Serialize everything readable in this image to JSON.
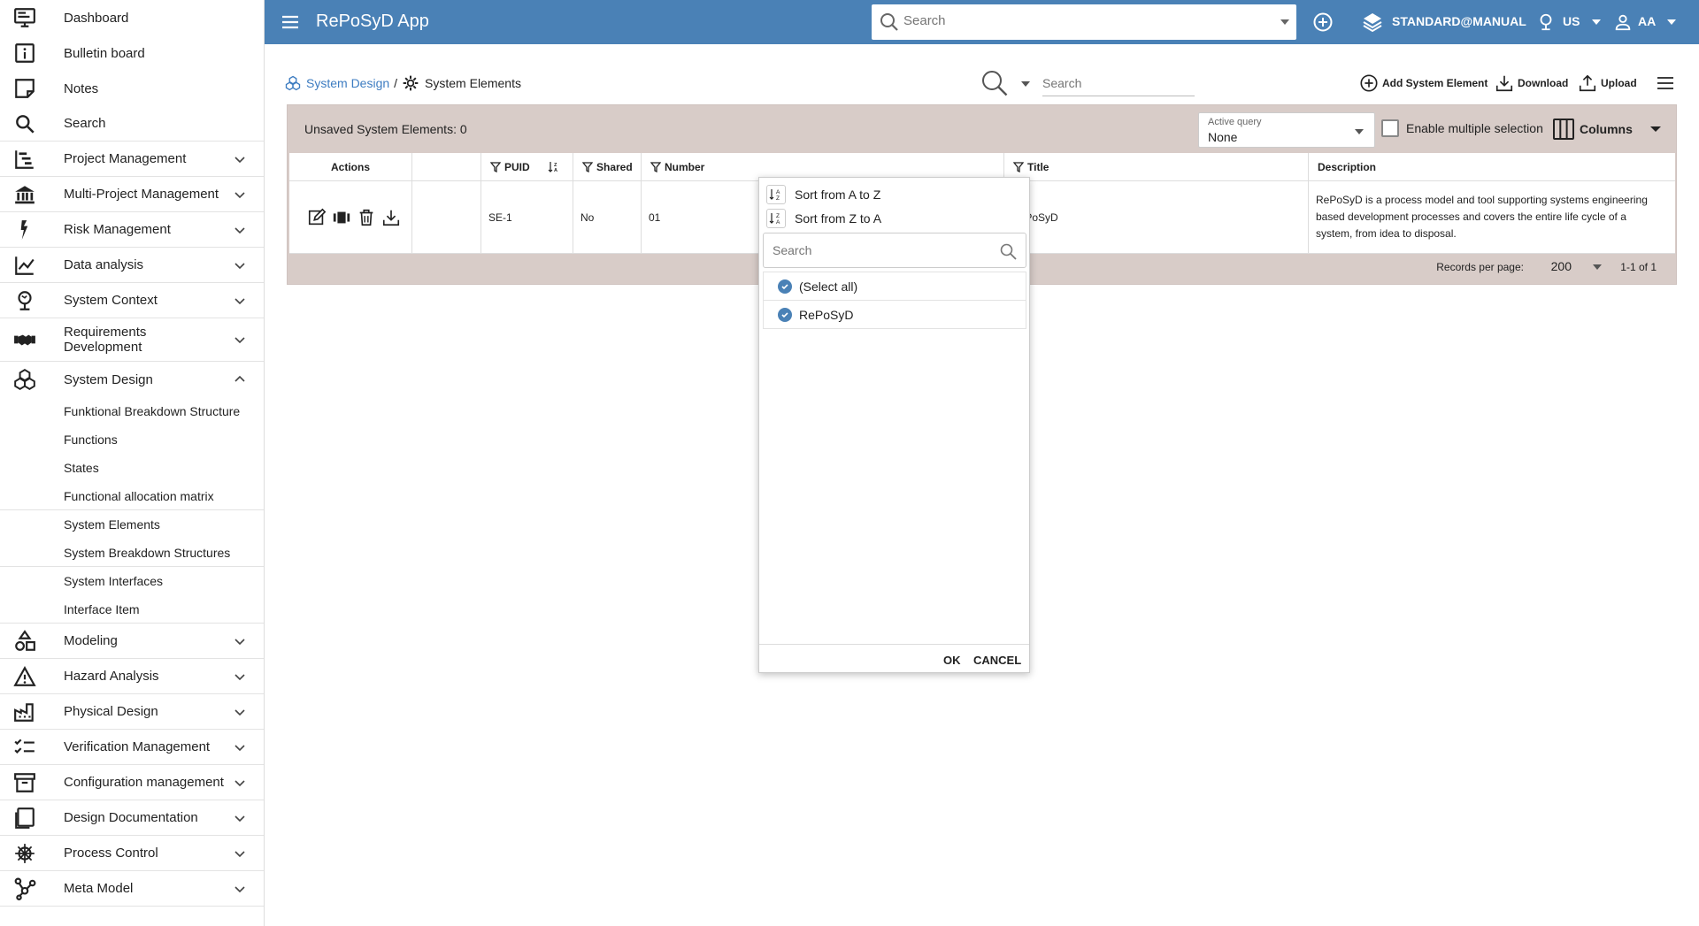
{
  "sidebar": {
    "top_items": [
      {
        "label": "Dashboard",
        "icon": "monitor-icon"
      },
      {
        "label": "Bulletin board",
        "icon": "info-icon"
      },
      {
        "label": "Notes",
        "icon": "note-icon"
      },
      {
        "label": "Search",
        "icon": "search-icon"
      }
    ],
    "sections": [
      {
        "label": "Project Management",
        "icon": "project-icon"
      },
      {
        "label": "Multi-Project Management",
        "icon": "bank-icon"
      },
      {
        "label": "Risk Management",
        "icon": "risk-icon"
      },
      {
        "label": "Data analysis",
        "icon": "chart-line-icon"
      },
      {
        "label": "System Context",
        "icon": "globe-icon"
      },
      {
        "label": "Requirements Development",
        "icon": "handshake-icon"
      }
    ],
    "system_design": {
      "label": "System Design",
      "icon": "cubes-icon",
      "children": [
        "Funktional Breakdown Structure",
        "Functions",
        "States",
        "Functional allocation matrix",
        "System Elements",
        "System Breakdown Structures",
        "System Interfaces",
        "Interface Item"
      ]
    },
    "bottom_sections": [
      {
        "label": "Modeling",
        "icon": "shapes-icon"
      },
      {
        "label": "Hazard Analysis",
        "icon": "warning-icon"
      },
      {
        "label": "Physical Design",
        "icon": "factory-icon"
      },
      {
        "label": "Verification Management",
        "icon": "checklist-icon"
      },
      {
        "label": "Configuration management",
        "icon": "archive-icon"
      },
      {
        "label": "Design Documentation",
        "icon": "document-icon"
      },
      {
        "label": "Process Control",
        "icon": "helm-icon"
      },
      {
        "label": "Meta Model",
        "icon": "graph-icon"
      }
    ]
  },
  "topbar": {
    "app_title": "RePoSyD App",
    "search_placeholder": "Search",
    "context": "STANDARD@MANUAL",
    "locale": "US",
    "user": "AA"
  },
  "breadcrumb": {
    "parent": "System Design",
    "separator": "/",
    "current": "System Elements"
  },
  "toolbar": {
    "search_placeholder": "Search",
    "add_label": "Add System Element",
    "download_label": "Download",
    "upload_label": "Upload"
  },
  "grid": {
    "unsaved_label": "Unsaved System Elements: 0",
    "active_query_label": "Active query",
    "active_query_value": "None",
    "multi_select_label": "Enable multiple selection",
    "columns_label": "Columns",
    "headers": {
      "actions": "Actions",
      "blank": "",
      "puid": "PUID",
      "shared": "Shared",
      "number": "Number",
      "title": "Title",
      "description": "Description"
    },
    "rows": [
      {
        "puid": "SE-1",
        "shared": "No",
        "number": "01",
        "title": "RePoSyD",
        "description": "RePoSyD is a process model and tool supporting systems engineering based development processes and covers the entire life cycle of a system, from idea to disposal."
      }
    ],
    "footer": {
      "records_per_page_label": "Records per page:",
      "records_per_page": "200",
      "range": "1-1 of 1"
    }
  },
  "filter_popup": {
    "sort_asc": "Sort from A to Z",
    "sort_desc": "Sort from Z to A",
    "search_placeholder": "Search",
    "options": [
      "(Select all)",
      "RePoSyD"
    ],
    "ok": "OK",
    "cancel": "CANCEL"
  },
  "colors": {
    "topbar": "#4a81b6",
    "panel": "#d8ccc8",
    "link": "#3d7cc1"
  }
}
